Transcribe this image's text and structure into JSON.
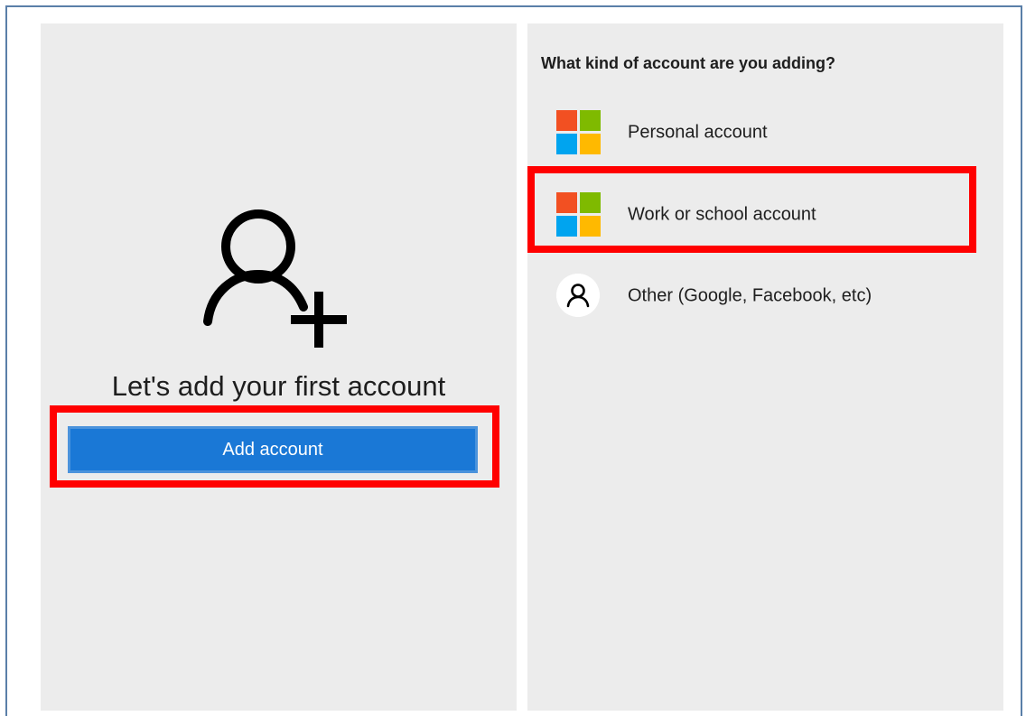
{
  "left": {
    "heading": "Let's add your first account",
    "add_button_label": "Add account"
  },
  "right": {
    "question": "What kind of account are you adding?",
    "options": [
      {
        "label": "Personal account",
        "icon": "microsoft-logo-icon"
      },
      {
        "label": "Work or school account",
        "icon": "microsoft-logo-icon"
      },
      {
        "label": "Other (Google, Facebook, etc)",
        "icon": "person-icon"
      }
    ]
  },
  "colors": {
    "accent_blue": "#1a78d6",
    "highlight_red": "#ff0000",
    "panel_bg": "#ececec",
    "ms_red": "#f25022",
    "ms_green": "#7fba00",
    "ms_blue": "#00a4ef",
    "ms_yellow": "#ffb900"
  }
}
